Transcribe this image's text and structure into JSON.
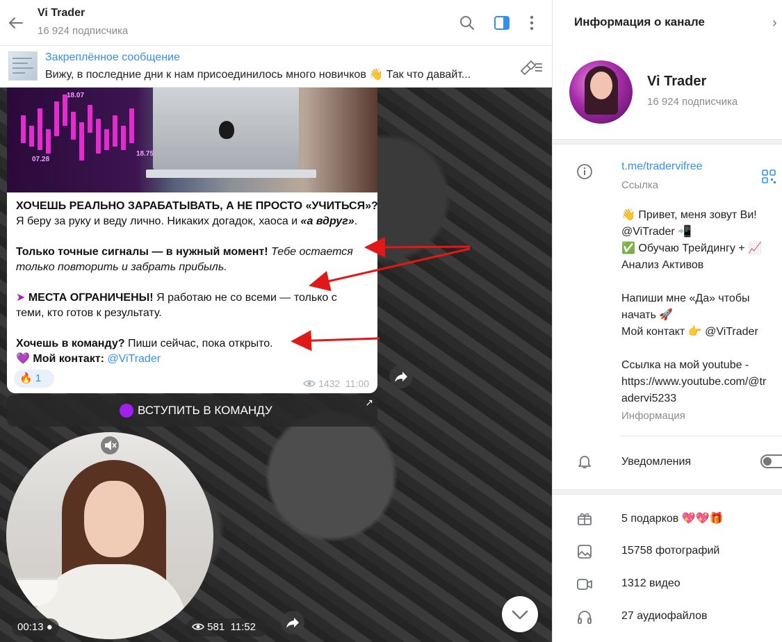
{
  "chat": {
    "title": "Vi Trader",
    "subscribers": "16 924 подписчика"
  },
  "pinned": {
    "title": "Закреплённое сообщение",
    "text": "Вижу, в последние дни к нам присоединилось много новичков 👋  Так что давайт..."
  },
  "photo": {
    "label_top": "18.07",
    "label_bottom_left": "07.28",
    "label_bottom_right": "18.75"
  },
  "message": {
    "line1": "ХОЧЕШЬ РЕАЛЬНО ЗАРАБАТЫВАТЬ, А НЕ ПРОСТО «УЧИТЬСЯ»?",
    "line2": "Я беру за руку и веду лично. Никаких догадок, хаоса и ",
    "line2_em": "«а вдруг»",
    "line2_end": ".",
    "line3_bold": "Только точные сигналы — в нужный момент!",
    "line3_it": " Тебе остается",
    "line4_it": "только повторить и забрать прибыль.",
    "line5_bullet": "➤",
    "line5_bold": " МЕСТА ОГРАНИЧЕНЫ!",
    "line5": " Я работаю не со всеми — только с",
    "line6": "теми, кто готов к результату.",
    "line7_bold": "Хочешь в команду?",
    "line7": " Пиши сейчас, пока открыто.",
    "line8_icon": "💜",
    "line8_bold": " Мой контакт: ",
    "line8_link": "@ViTrader",
    "reaction_emoji": "🔥",
    "reaction_count": "1",
    "views": "1432",
    "time": "11:00"
  },
  "join_button": {
    "label": "ВСТУПИТЬ В КОМАНДУ",
    "arrow": "↗"
  },
  "video": {
    "duration": "00:13 ●",
    "views": "581",
    "time": "11:52"
  },
  "info": {
    "title": "Информация о канале",
    "close": "›",
    "name": "Vi Trader",
    "subscribers": "16 924 подписчика",
    "link": "t.me/tradervifree",
    "link_caption": "Ссылка",
    "bio": [
      "👋 Привет, меня зовут Ви!",
      "@ViTrader 📲",
      "✅ Обучаю Трейдингу + 📈",
      "Анализ Активов",
      "",
      "Напиши мне «Да» чтобы",
      "начать 🚀",
      "Мой контакт 👉 @ViTrader",
      "",
      "Ссылка на мой youtube -",
      "https://www.youtube.com/@tr",
      "adervi5233"
    ],
    "bio_caption": "Информация",
    "notifications": "Уведомления",
    "gifts": "5 подарков 💖💖🎁",
    "photos": "15758 фотографий",
    "videos": "1312 видео",
    "audio": "27 аудиофайлов"
  },
  "colors": {
    "accent": "#3390ec",
    "arrow_red": "#e01818"
  }
}
